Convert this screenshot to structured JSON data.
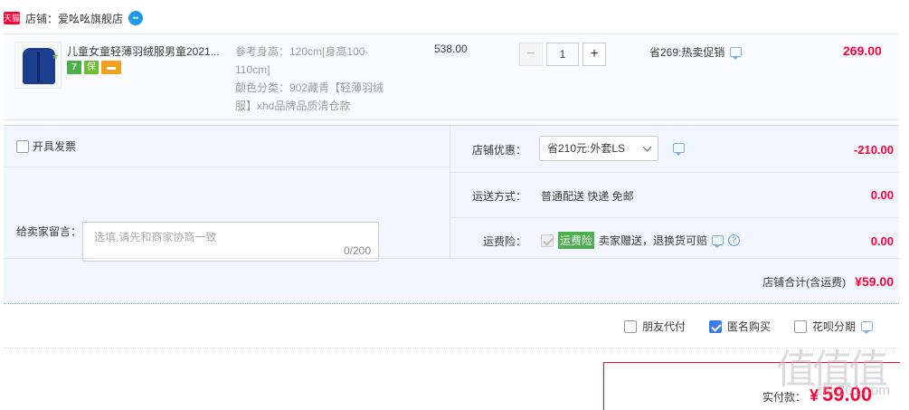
{
  "shop": {
    "badge": "天猫",
    "label": "店铺：爱吆吆旗舰店",
    "ww_icon": "wangwang-icon"
  },
  "item": {
    "title": "儿童女童轻薄羽绒服男童2021...",
    "service_icons": [
      {
        "name": "seven-day-return-icon",
        "text": "7"
      },
      {
        "name": "guarantee-icon",
        "text": "保"
      },
      {
        "name": "credit-card-icon",
        "text": "▬"
      }
    ],
    "sku_line1": "参考身高：120cm[身高100-110cm]",
    "sku_line2": "颜色分类：902藏青【轻薄羽绒服】xhd品牌品质清仓款",
    "unit_price": "538.00",
    "quantity": "1",
    "minus": "−",
    "plus": "+",
    "promo": "省269:热卖促销",
    "total": "269.00"
  },
  "options": {
    "invoice_label": "开具发票",
    "message_label": "给卖家留言：",
    "message_placeholder": "选填,请先和商家协商一致",
    "message_count": "0/200",
    "shop_discount_label": "店铺优惠：",
    "shop_discount_selected": "省210元:外套LS",
    "shop_discount_value": "-210.00",
    "shipping_label": "运送方式：",
    "shipping_text": "普通配送 快递 免邮",
    "shipping_value": "0.00",
    "insurance_label": "运费险：",
    "insurance_badge": "运费险",
    "insurance_text": "卖家赠送，退换货可赔",
    "insurance_value": "0.00",
    "subtotal_label": "店铺合计(含运费)",
    "subtotal_value": "¥59.00"
  },
  "payment_options": [
    {
      "label": "朋友代付",
      "checked": false
    },
    {
      "label": "匿名购买",
      "checked": true
    },
    {
      "label": "花呗分期",
      "checked": false
    }
  ],
  "total": {
    "label": "实付款：",
    "currency": "¥",
    "amount": "59.00"
  },
  "watermark": {
    "text": "值值值",
    "sub": "zhi Z01.com"
  },
  "colors": {
    "accent_red": "#ff0036",
    "panel_bg": "#f2f7ff",
    "checkbox_blue": "#3b7be8"
  }
}
